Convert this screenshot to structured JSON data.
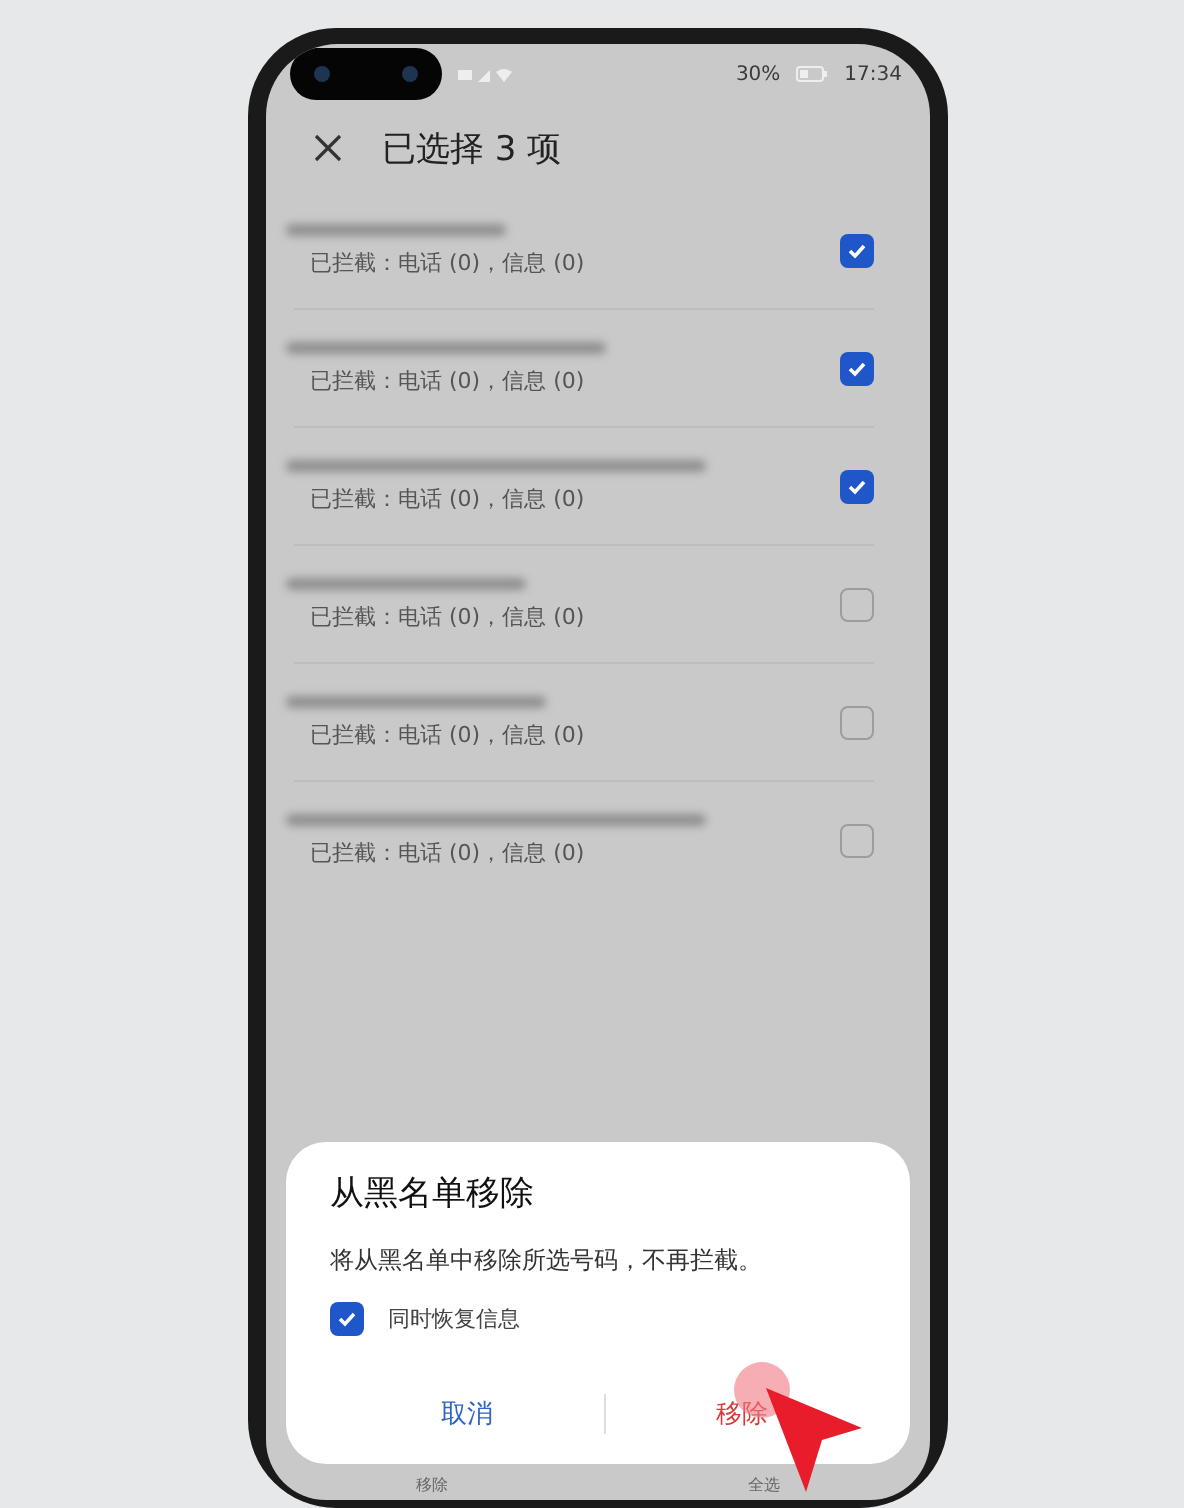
{
  "status_bar": {
    "battery": "30%",
    "time": "17:34"
  },
  "header": {
    "title": "已选择 3 项"
  },
  "rows": [
    {
      "detail": "已拦截：电话 (0)，信息 (0)",
      "checked": true
    },
    {
      "detail": "已拦截：电话 (0)，信息 (0)",
      "checked": true
    },
    {
      "detail": "已拦截：电话 (0)，信息 (0)",
      "checked": true
    },
    {
      "detail": "已拦截：电话 (0)，信息 (0)",
      "checked": false
    },
    {
      "detail": "已拦截：电话 (0)，信息 (0)",
      "checked": false
    },
    {
      "detail": "已拦截：电话 (0)，信息 (0)",
      "checked": false
    }
  ],
  "bottom_bar": [
    "移除",
    "全选"
  ],
  "dialog": {
    "title": "从黑名单移除",
    "message": "将从黑名单中移除所选号码，不再拦截。",
    "option": {
      "label": "同时恢复信息",
      "checked": true
    },
    "buttons": [
      {
        "label": "取消",
        "kind": "cancel"
      },
      {
        "label": "移除",
        "kind": "danger"
      }
    ]
  }
}
